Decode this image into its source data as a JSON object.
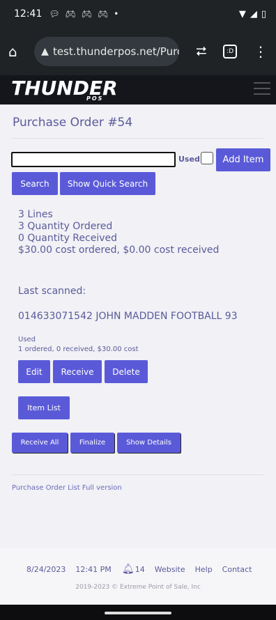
{
  "status": {
    "time": "12:41",
    "notif_icons": [
      "chat-bubble-icon",
      "gamepad-icon",
      "gamepad-icon",
      "gamepad-icon",
      "dot-icon"
    ]
  },
  "browser": {
    "url": "test.thunderpos.net/Purc"
  },
  "site": {
    "logo_text": "THUNDER",
    "logo_sub": "POS"
  },
  "page": {
    "title": "Purchase Order #54",
    "used_label": "Used",
    "add_item_label": "Add Item",
    "search_label": "Search",
    "show_quick_search_label": "Show Quick Search",
    "summary": {
      "lines": "3 Lines",
      "qty_ordered": "3 Quantity Ordered",
      "qty_received": "0 Quantity Received",
      "cost": "$30.00 cost ordered, $0.00 cost received"
    },
    "last_scanned_label": "Last scanned:",
    "scanned_item": "014633071542 JOHN MADDEN FOOTBALL 93",
    "item_condition": "Used",
    "item_detail": "1 ordered, 0 received, $30.00 cost",
    "edit_label": "Edit",
    "receive_label": "Receive",
    "delete_label": "Delete",
    "item_list_label": "Item List",
    "receive_all_label": "Receive All",
    "finalize_label": "Finalize",
    "show_details_label": "Show Details",
    "po_list_link": "Purchase Order List",
    "full_version_link": "Full version"
  },
  "footer": {
    "date": "8/24/2023",
    "time": "12:41 PM",
    "bell_count": "14",
    "website": "Website",
    "help": "Help",
    "contact": "Contact",
    "copyright": "2019-2023 © Extreme Point of Sale, Inc"
  },
  "colors": {
    "accent": "#5a5ad8",
    "text": "#5a5a9a",
    "header_bg": "#15161c"
  }
}
